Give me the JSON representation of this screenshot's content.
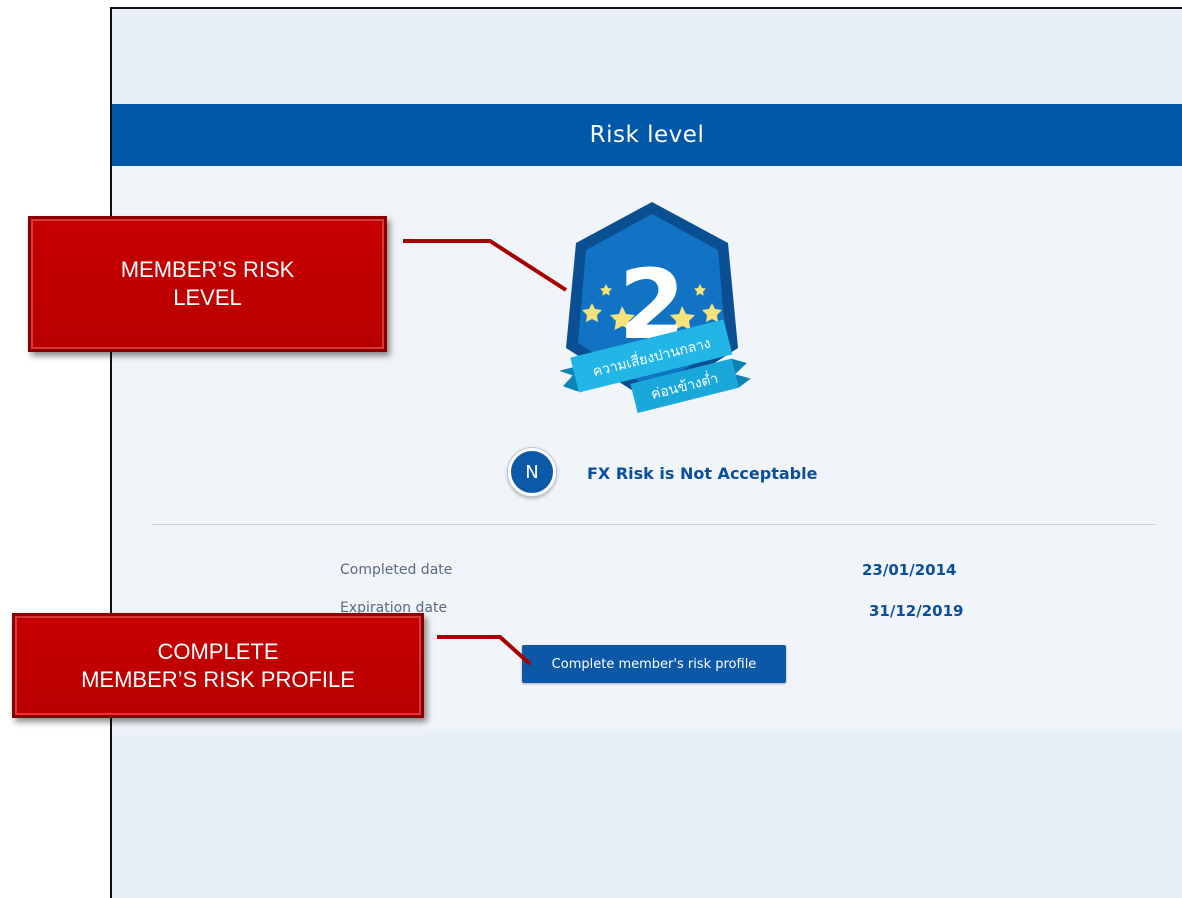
{
  "header": {
    "title": "Risk level"
  },
  "badge": {
    "level": "2",
    "ribbon_line1": "ความเสี่ยงปานกลาง",
    "ribbon_line2": "ค่อนข้างต่ำ"
  },
  "fx": {
    "icon_letter": "N",
    "status": "FX Risk is Not Acceptable"
  },
  "details": {
    "completed_label": "Completed date",
    "completed_value": "23/01/2014",
    "expiration_label": "Expiration date",
    "expiration_value": "31/12/2019"
  },
  "actions": {
    "complete_profile_label": "Complete member's risk profile"
  },
  "callouts": {
    "risk_level_line1": "MEMBER’S RISK",
    "risk_level_line2": "LEVEL",
    "complete_profile_line1": "COMPLETE",
    "complete_profile_line2": "MEMBER’S RISK PROFILE"
  },
  "colors": {
    "header_blue": "#0057a8",
    "callout_red": "#c00000",
    "badge_blue": "#0b6fc0",
    "ribbon_cyan": "#1fb1e3"
  }
}
